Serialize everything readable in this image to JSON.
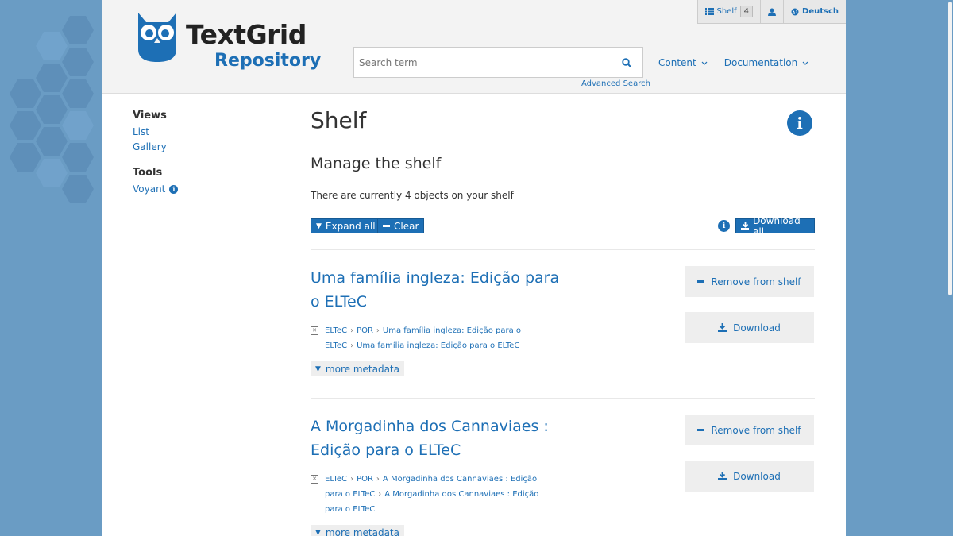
{
  "header": {
    "logo_title": "TextGrid",
    "logo_subtitle": "Repository",
    "topbar": {
      "shelf_label": "Shelf",
      "shelf_count": "4",
      "language": "Deutsch"
    },
    "search": {
      "placeholder": "Search term",
      "advanced_label": "Advanced Search"
    },
    "nav": {
      "content_label": "Content",
      "documentation_label": "Documentation"
    }
  },
  "sidebar": {
    "views_heading": "Views",
    "views": [
      "List",
      "Gallery"
    ],
    "tools_heading": "Tools",
    "tools": [
      "Voyant"
    ]
  },
  "main": {
    "title": "Shelf",
    "subtitle": "Manage the shelf",
    "count_text": "There are currently 4 objects on your shelf",
    "expand_all_label": "Expand all",
    "clear_label": "Clear",
    "download_all_label": "Download all",
    "items": [
      {
        "title": "Uma família ingleza: Edição para o ELTeC",
        "breadcrumb": [
          "ELTeC",
          "POR",
          "Uma família ingleza: Edição para o ELTeC",
          "Uma família ingleza: Edição para o ELTeC"
        ],
        "more_metadata": "more metadata",
        "remove_label": "Remove from shelf",
        "download_label": "Download"
      },
      {
        "title": "A Morgadinha dos Cannaviaes : Edição para o ELTeC",
        "breadcrumb": [
          "ELTeC",
          "POR",
          "A Morgadinha dos Cannaviaes : Edição para o ELTeC",
          "A Morgadinha dos Cannaviaes : Edição para o ELTeC"
        ],
        "more_metadata": "more metadata",
        "remove_label": "Remove from shelf",
        "download_label": "Download"
      }
    ]
  },
  "colors": {
    "accent": "#1d6fb5",
    "background": "#6a9cc4",
    "header_bg": "#f3f3f3"
  }
}
